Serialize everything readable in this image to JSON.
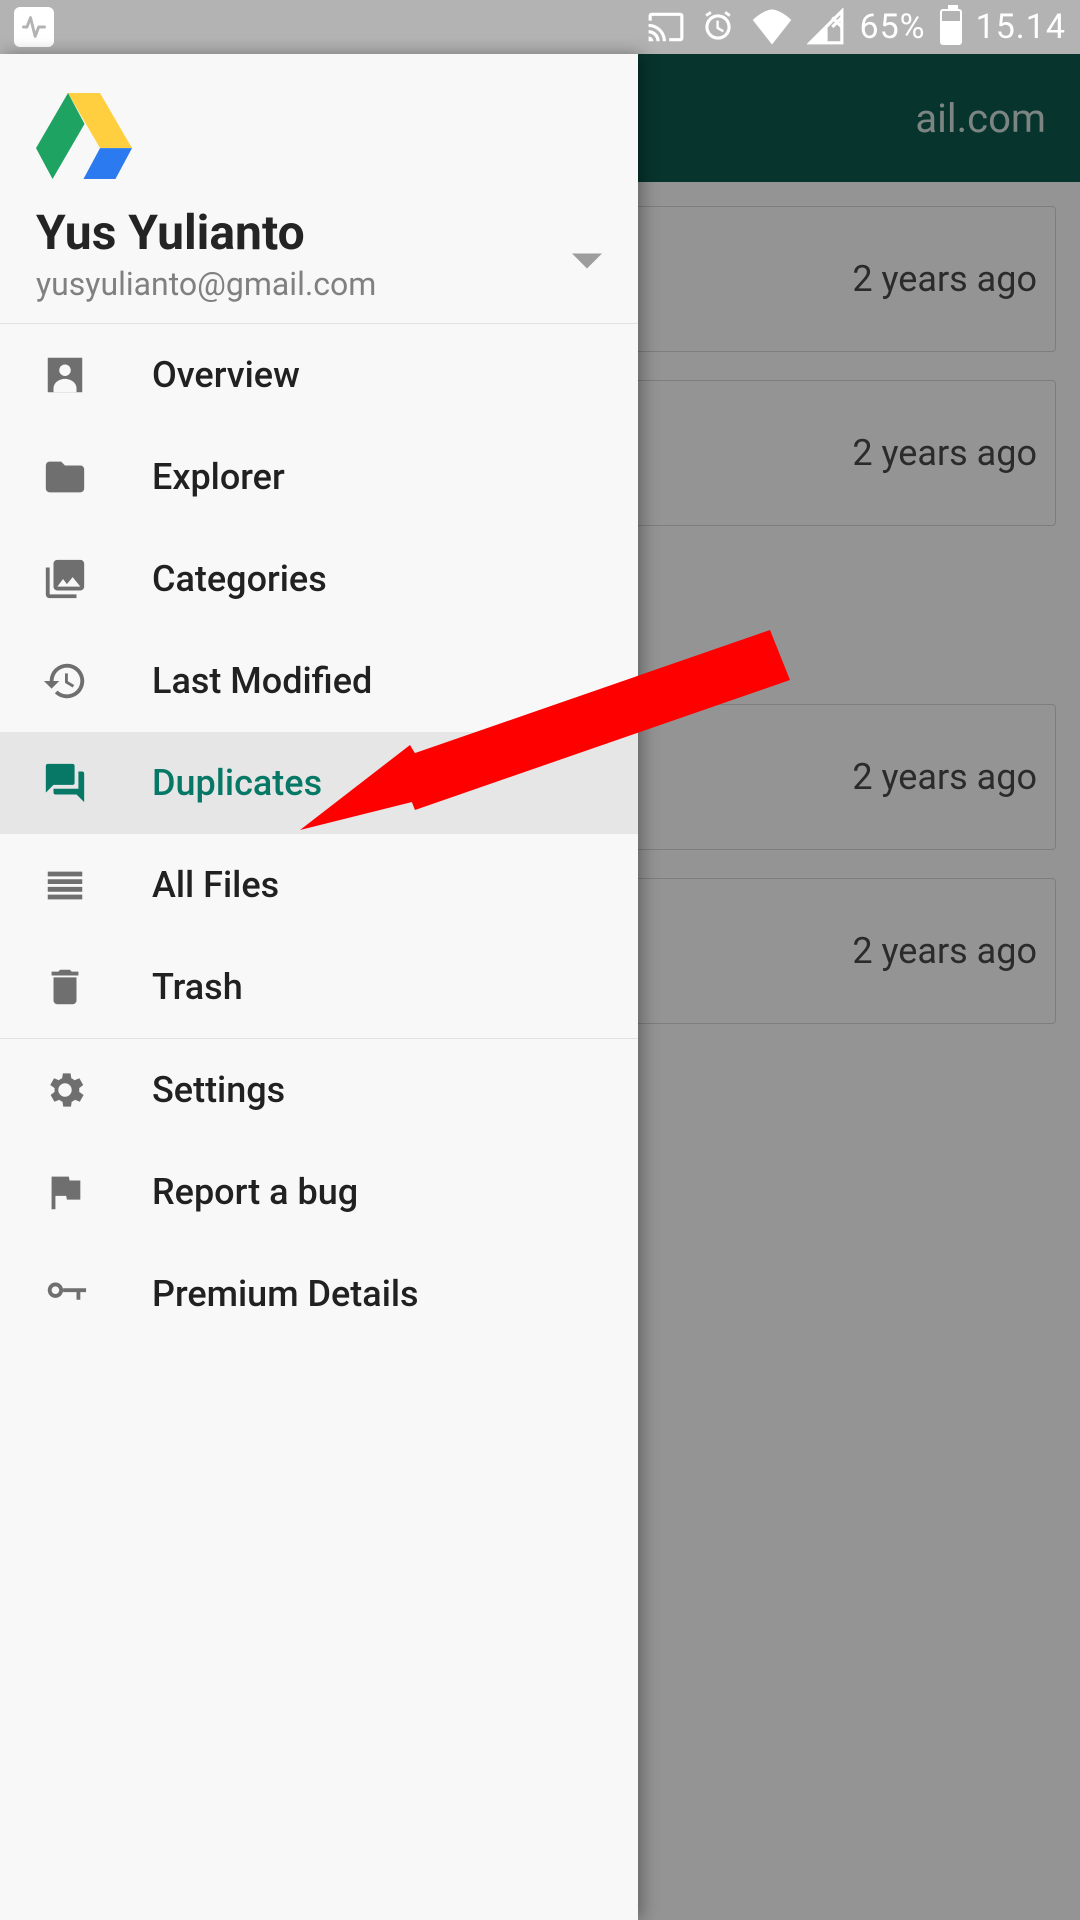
{
  "status_bar": {
    "battery_pct": "65%",
    "clock": "15.14"
  },
  "background_app": {
    "header_text_fragment": "ail.com",
    "file_time_labels": [
      "2 years ago",
      "2 years ago",
      "2 years ago",
      "2 years ago"
    ]
  },
  "drawer": {
    "account": {
      "name": "Yus Yulianto",
      "email": "yusyulianto@gmail.com"
    },
    "items": [
      {
        "label": "Overview",
        "icon": "person-card-icon"
      },
      {
        "label": "Explorer",
        "icon": "folder-icon"
      },
      {
        "label": "Categories",
        "icon": "collections-icon"
      },
      {
        "label": "Last Modified",
        "icon": "history-icon"
      },
      {
        "label": "Duplicates",
        "icon": "chat-bubbles-icon",
        "active": true
      },
      {
        "label": "All Files",
        "icon": "list-lines-icon"
      },
      {
        "label": "Trash",
        "icon": "trash-icon"
      },
      {
        "label": "Settings",
        "icon": "gear-icon"
      },
      {
        "label": "Report a bug",
        "icon": "flag-icon"
      },
      {
        "label": "Premium Details",
        "icon": "key-icon"
      }
    ]
  },
  "accent_color": "#077866"
}
